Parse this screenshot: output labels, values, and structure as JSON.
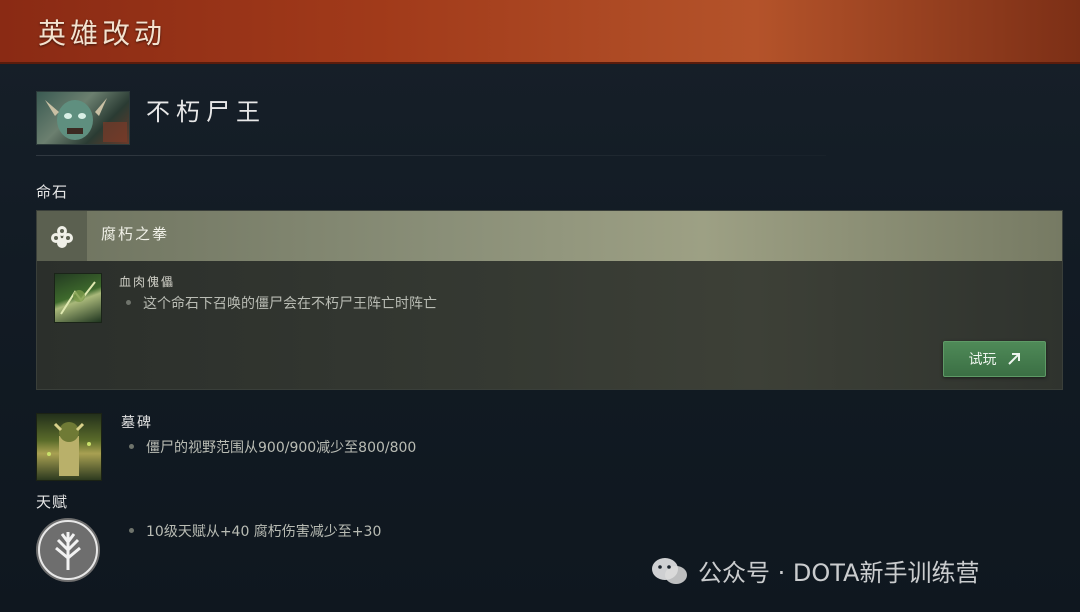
{
  "header": {
    "title": "英雄改动"
  },
  "hero": {
    "name": "不朽尸王",
    "portrait_icon": "undying-portrait"
  },
  "sections": {
    "facet_label": "命石",
    "talent_label": "天赋"
  },
  "facet": {
    "name": "腐朽之拳",
    "icon": "facet-cluster-icon",
    "ability": {
      "name": "血肉傀儡",
      "icon": "flesh-golem-icon",
      "bullets": [
        "这个命石下召唤的僵尸会在不朽尸王阵亡时阵亡"
      ]
    },
    "try_button": {
      "label": "试玩",
      "icon": "arrow-up-right-icon"
    }
  },
  "tombstone": {
    "name": "墓碑",
    "icon": "tombstone-icon",
    "bullets": [
      "僵尸的视野范围从900/900减少至800/800"
    ]
  },
  "talent": {
    "icon": "talent-tree-icon",
    "bullets": [
      "10级天赋从+40 腐朽伤害减少至+30"
    ]
  },
  "watermark": {
    "text": "公众号 · DOTA新手训练营",
    "icon": "wechat-icon"
  },
  "colors": {
    "header": "#a13a1a",
    "button": "#437a4c"
  }
}
